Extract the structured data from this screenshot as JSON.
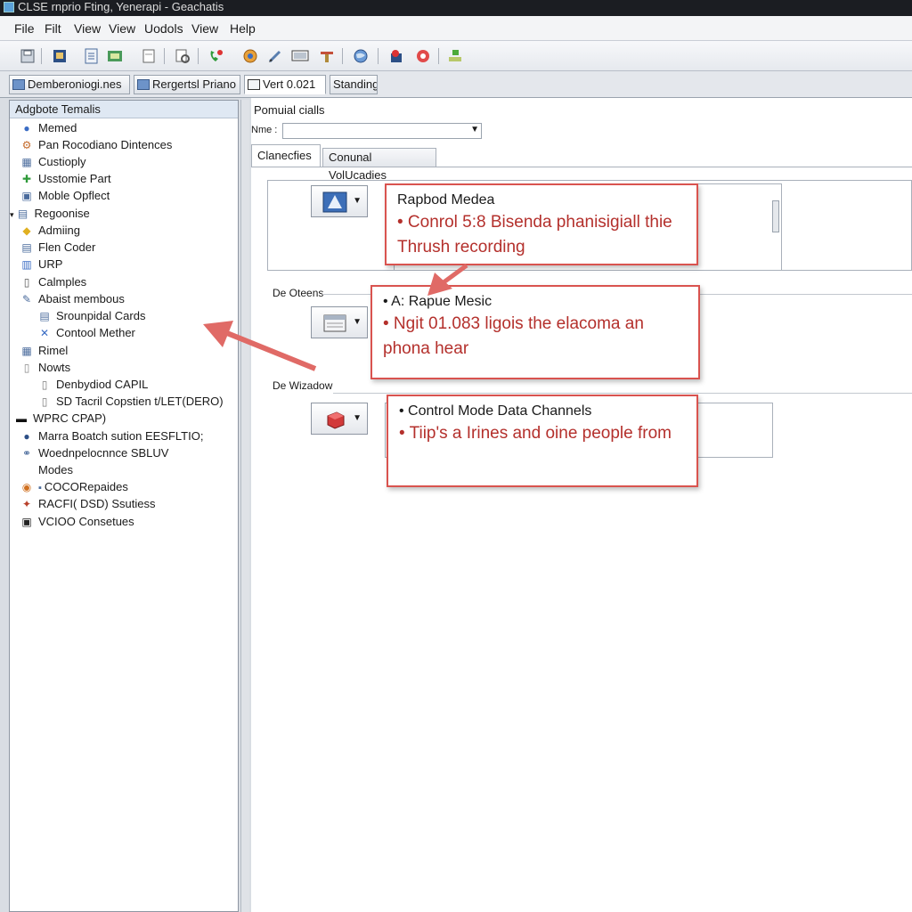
{
  "window": {
    "title": "CLSE rnprio Fting, Yenerapi - Geachatis"
  },
  "menu": [
    "File",
    "Filt",
    "View",
    "View",
    "Uodols",
    "View",
    "Help"
  ],
  "toolbar_icons": [
    "save-icon",
    "device-icon",
    "list-icon",
    "config-icon",
    "page-icon",
    "search-doc-icon",
    "phone-icon",
    "refresh-icon",
    "edit-icon",
    "monitor-icon",
    "tools-icon",
    "globe-icon",
    "record-icon",
    "stop-icon",
    "network-icon"
  ],
  "tabs": [
    {
      "label": "Demberoniogi.nes",
      "active": false
    },
    {
      "label": "Rergertsl Priano",
      "active": false
    },
    {
      "label": "Vert 0.021",
      "active": true
    },
    {
      "label": "Standing",
      "active": false
    }
  ],
  "sidebar": {
    "header": "Adgbote Temalis",
    "items": [
      {
        "label": "Memed",
        "icon": "circle-icon"
      },
      {
        "label": "Pan Rocodiano Dintences",
        "icon": "gear-icon"
      },
      {
        "label": "Custioply",
        "icon": "grid-icon"
      },
      {
        "label": "Usstomie Part",
        "icon": "puzzle-icon"
      },
      {
        "label": "Moble Opflect",
        "icon": "window-icon"
      },
      {
        "label": "Regoonise",
        "icon": "document-icon"
      },
      {
        "label": "Admiing",
        "icon": "diamond-icon"
      },
      {
        "label": "Flen Coder",
        "icon": "code-icon"
      },
      {
        "label": "URP",
        "icon": "list-icon"
      },
      {
        "label": "Calmples",
        "icon": "sample-icon"
      },
      {
        "label": "Abaist membous",
        "icon": "tool-icon"
      },
      {
        "label": "Srounpidal Cards",
        "icon": "card-icon"
      },
      {
        "label": "Contool Mether",
        "icon": "cross-icon"
      },
      {
        "label": "Rimel",
        "icon": "grid-icon"
      },
      {
        "label": "Nowts",
        "icon": "note-icon"
      },
      {
        "label": "Denbydiod CAPIL",
        "icon": "file-icon"
      },
      {
        "label": "SD Tacril Copstien t/LET(DERO)",
        "icon": "file-icon"
      },
      {
        "label": "WPRC CPAP)",
        "icon": "terminal-icon"
      },
      {
        "label": "Marra Boatch sution EESFLTIO;",
        "icon": "globe-icon"
      },
      {
        "label": "Woednpelocnnce SBLUV",
        "icon": "link-icon"
      },
      {
        "label": "Modes",
        "icon": "blank-icon"
      },
      {
        "label": "COCORepaides",
        "icon": "disc-icon"
      },
      {
        "label": "RACFI( DSD) Ssutiess",
        "icon": "settings-icon"
      },
      {
        "label": "VCIOO Consetues",
        "icon": "console-icon"
      }
    ]
  },
  "panel": {
    "title": "Pomuial cialls",
    "name_label": "Nme :",
    "name_value": "",
    "subtabs": [
      "Clanecfies",
      "Conunal VolUcadies"
    ],
    "sections": [
      {
        "label": "De Oteens"
      },
      {
        "label": "De Wizadow"
      }
    ]
  },
  "callouts": [
    {
      "head": "Rapbod Medea",
      "body": "• Conrol 5:8 Bisenda phanisigiall thie Thrush recording"
    },
    {
      "head": "• A: Rapue Mesic",
      "body": "• Ngit 01.083 ligois the elacoma an phona hear"
    },
    {
      "head": "• Control Mode Data Channels",
      "body": "• Tiip's a Irines and oine people from"
    }
  ],
  "colors": {
    "callout_border": "#d9534f",
    "callout_text": "#b4302c",
    "arrow": "#e06a66"
  }
}
